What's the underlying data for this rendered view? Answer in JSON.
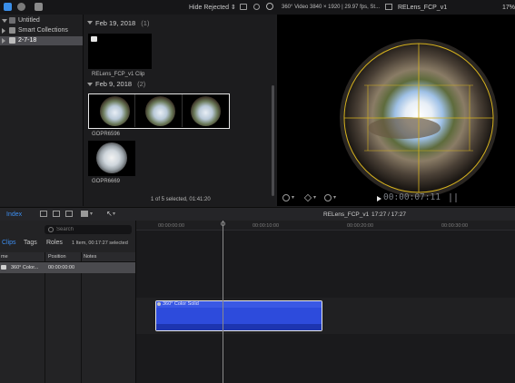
{
  "toolbar": {
    "hide_rejected_label": "Hide Rejected ⇕",
    "video_format": "360° Video 3840 × 1920 | 29.97 fps, St...",
    "viewer_project_title": "RELens_FCP_v1",
    "zoom": "17%"
  },
  "sidebar": {
    "items": [
      {
        "label": "Untitled"
      },
      {
        "label": "Smart Collections"
      },
      {
        "label": "2-7-18"
      }
    ]
  },
  "browser": {
    "groups": [
      {
        "date": "Feb 19, 2018",
        "count": "(1)",
        "clips": [
          "RELens_FCP_v1 Clip"
        ]
      },
      {
        "date": "Feb 9, 2018",
        "count": "(2)",
        "clips": [
          "GOPR6596",
          "GOPR6669"
        ]
      }
    ],
    "status": "1 of 5 selected, 01:41:20"
  },
  "viewer": {
    "timecode": "00:00:07:11"
  },
  "timeline_toolbar": {
    "index_label": "Index",
    "project_name": "RELens_FCP_v1",
    "duration": "17:27 / 17:27"
  },
  "index_panel": {
    "search_placeholder": "Search",
    "tabs": [
      "Clips",
      "Tags",
      "Roles"
    ],
    "summary": "1 Item, 00:17:27 selected",
    "columns": [
      "me",
      "Position",
      "Notes"
    ],
    "rows": [
      {
        "name": "360° Color...",
        "position": "00:00:00:00",
        "notes": ""
      }
    ]
  },
  "timeline": {
    "ruler": [
      "00:00:00:00",
      "00:00:10:00",
      "00:00:20:00",
      "00:00:30:00"
    ],
    "clip_title": "360° Color Solid"
  },
  "colors": {
    "accent": "#3d8ef0",
    "clip_blue": "#2d4bdc",
    "reticle": "#d6b21e",
    "selection": "#4b4b50"
  }
}
